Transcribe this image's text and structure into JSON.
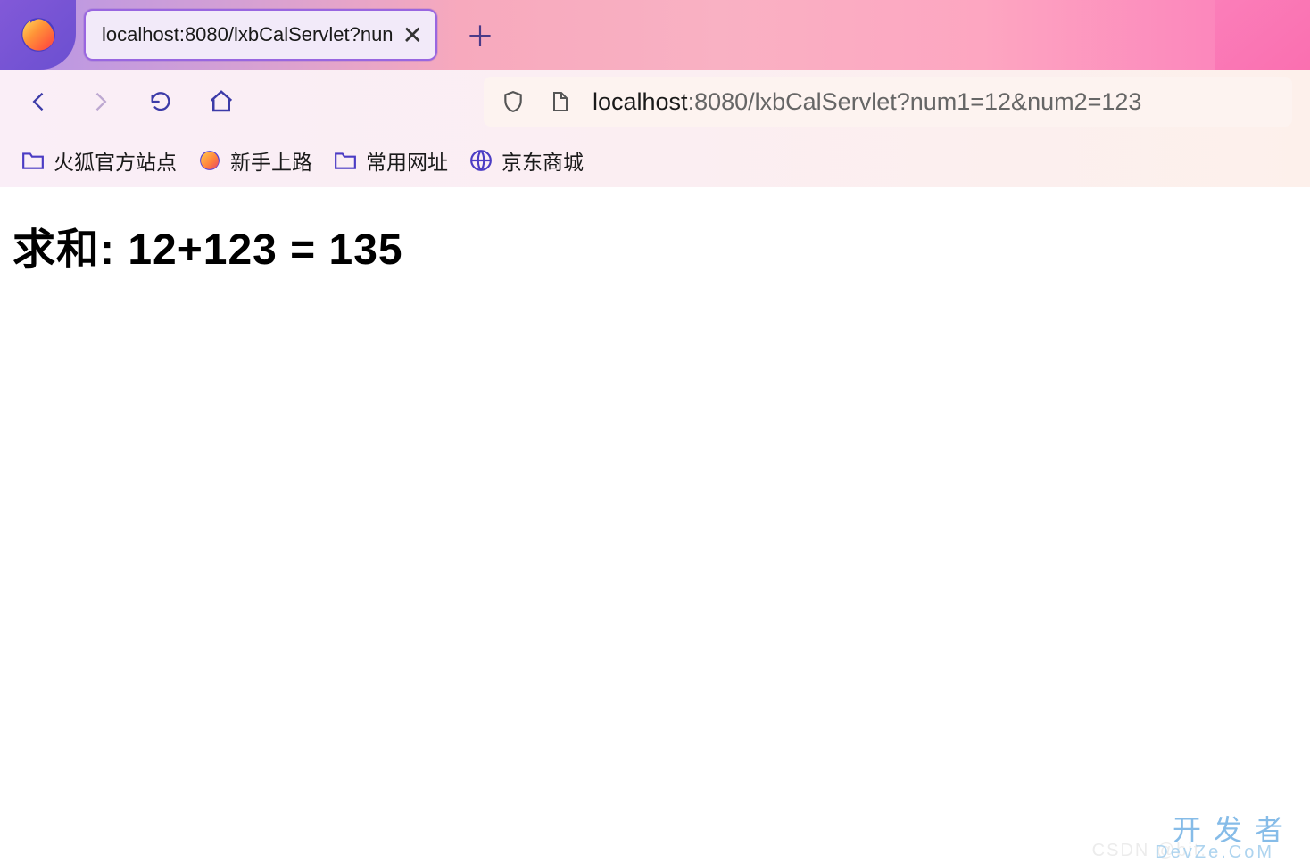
{
  "tab": {
    "title": "localhost:8080/lxbCalServlet?nun"
  },
  "url": {
    "host": "localhost",
    "path": ":8080/lxbCalServlet?num1=12&num2=123"
  },
  "bookmarks": [
    {
      "label": "火狐官方站点",
      "icon": "folder"
    },
    {
      "label": "新手上路",
      "icon": "firefox"
    },
    {
      "label": "常用网址",
      "icon": "folder"
    },
    {
      "label": "京东商城",
      "icon": "globe"
    }
  ],
  "content": {
    "heading": "求和: 12+123 = 135"
  },
  "watermark": {
    "main": "开发者",
    "sub": "DevZe.CoM",
    "ghost": "CSDN @bit..."
  }
}
